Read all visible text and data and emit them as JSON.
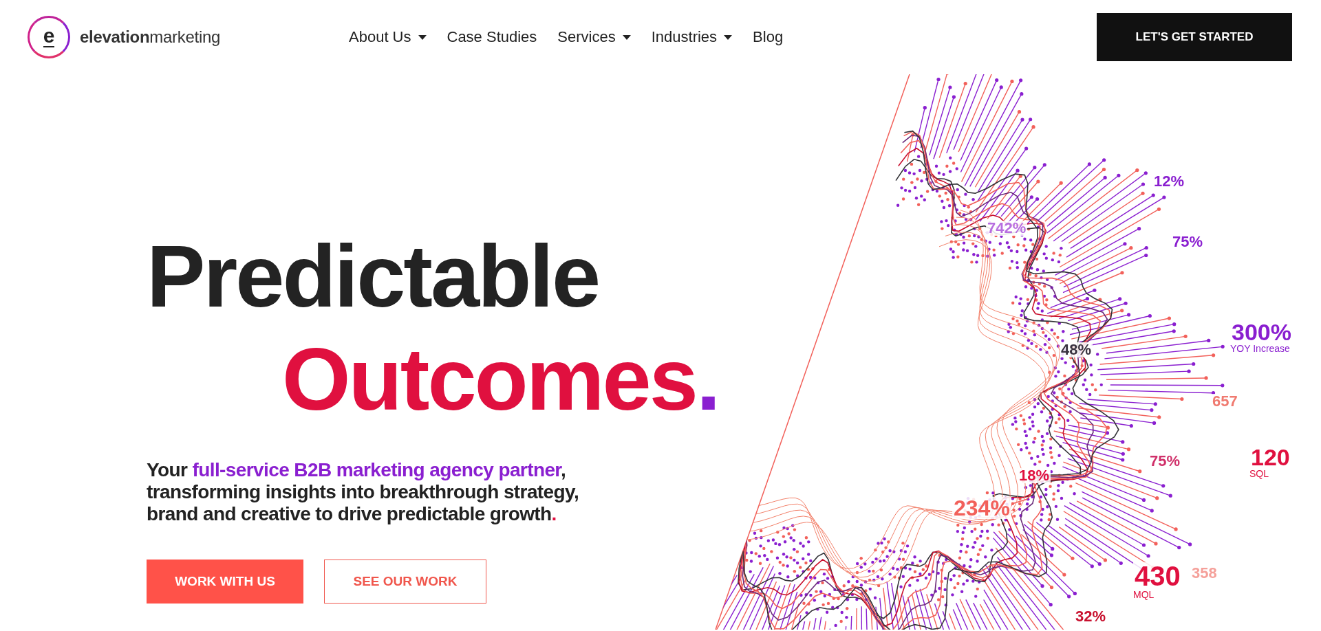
{
  "logo": {
    "mark": "e",
    "name_bold": "elevation",
    "name_regular": "marketing"
  },
  "nav": [
    {
      "label": "About Us",
      "dropdown": true
    },
    {
      "label": "Case Studies",
      "dropdown": false
    },
    {
      "label": "Services",
      "dropdown": true
    },
    {
      "label": "Industries",
      "dropdown": true
    },
    {
      "label": "Blog",
      "dropdown": false
    }
  ],
  "cta_button": "LET'S GET STARTED",
  "headline": {
    "line_1": "Predictable",
    "line_2": "Outcomes",
    "end": "."
  },
  "subtitle": {
    "lead": "Your ",
    "highlight": "full-service B2B marketing agency partner",
    "rest": ", transforming insights into breakthrough strategy, brand and creative to drive predictable growth",
    "end": "."
  },
  "buttons": [
    {
      "label": "WORK WITH US",
      "kind": "filled"
    },
    {
      "label": "SEE OUR WORK",
      "kind": "outline"
    }
  ],
  "artwork_labels": [
    {
      "text": "12%",
      "color": "#8a1fd0"
    },
    {
      "text": "742%",
      "color": "#b86ee0"
    },
    {
      "text": "75%",
      "color": "#8a1fd0"
    },
    {
      "text": "48%",
      "color": "#3a3340"
    },
    {
      "text": "300%",
      "sub": "YOY Increase",
      "color": "#8a1fd0"
    },
    {
      "text": "657",
      "color": "#f07a70"
    },
    {
      "text": "18%",
      "color": "#e0103f"
    },
    {
      "text": "75%",
      "color": "#d0306a"
    },
    {
      "text": "120",
      "sub": "SQL",
      "color": "#e0103f"
    },
    {
      "text": "234%",
      "color": "#f2605a"
    },
    {
      "text": "430",
      "sub": "MQL",
      "color": "#e0103f"
    },
    {
      "text": "358",
      "color": "#f5a09a"
    },
    {
      "text": "32%",
      "color": "#c8102e"
    }
  ]
}
